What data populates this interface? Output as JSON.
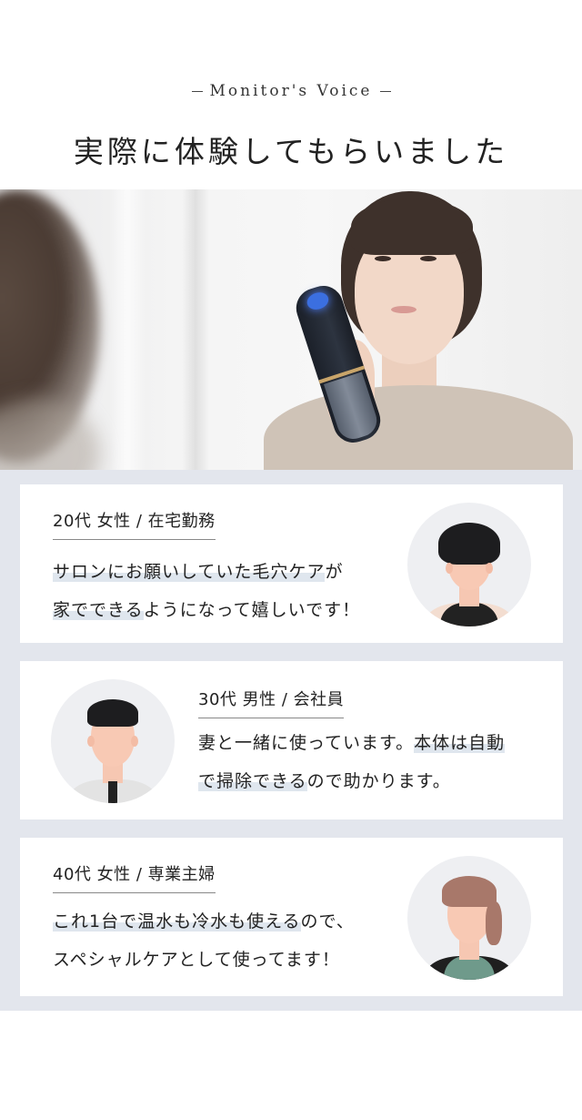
{
  "header": {
    "subtitle": "Monitor's Voice",
    "title": "実際に体験してもらいました"
  },
  "voices": [
    {
      "meta": "20代 女性 / 在宅勤務",
      "line1_hl": "サロンにお願いしていた毛穴ケア",
      "line1_rest": "が",
      "line2_hl": "家でできる",
      "line2_rest": "ようになって嬉しいです！",
      "avatar": "woman-short-hair-avatar"
    },
    {
      "meta": "30代 男性 / 会社員",
      "line1_plain": "妻と一緒に使っています。",
      "line1_hl": "本体は自動",
      "line2_hl": "で掃除できる",
      "line2_rest": "ので助かります。",
      "avatar": "man-tie-avatar"
    },
    {
      "meta": "40代 女性 / 専業主婦",
      "line1_hl": "これ1台で温水も冷水も使える",
      "line1_rest": "ので、",
      "line2_plain": "スペシャルケアとして使ってます！",
      "avatar": "woman-ponytail-avatar"
    }
  ],
  "colors": {
    "voices_bg": "#e3e6ed",
    "highlight": "#dfe6ee",
    "card_bg": "#ffffff"
  }
}
